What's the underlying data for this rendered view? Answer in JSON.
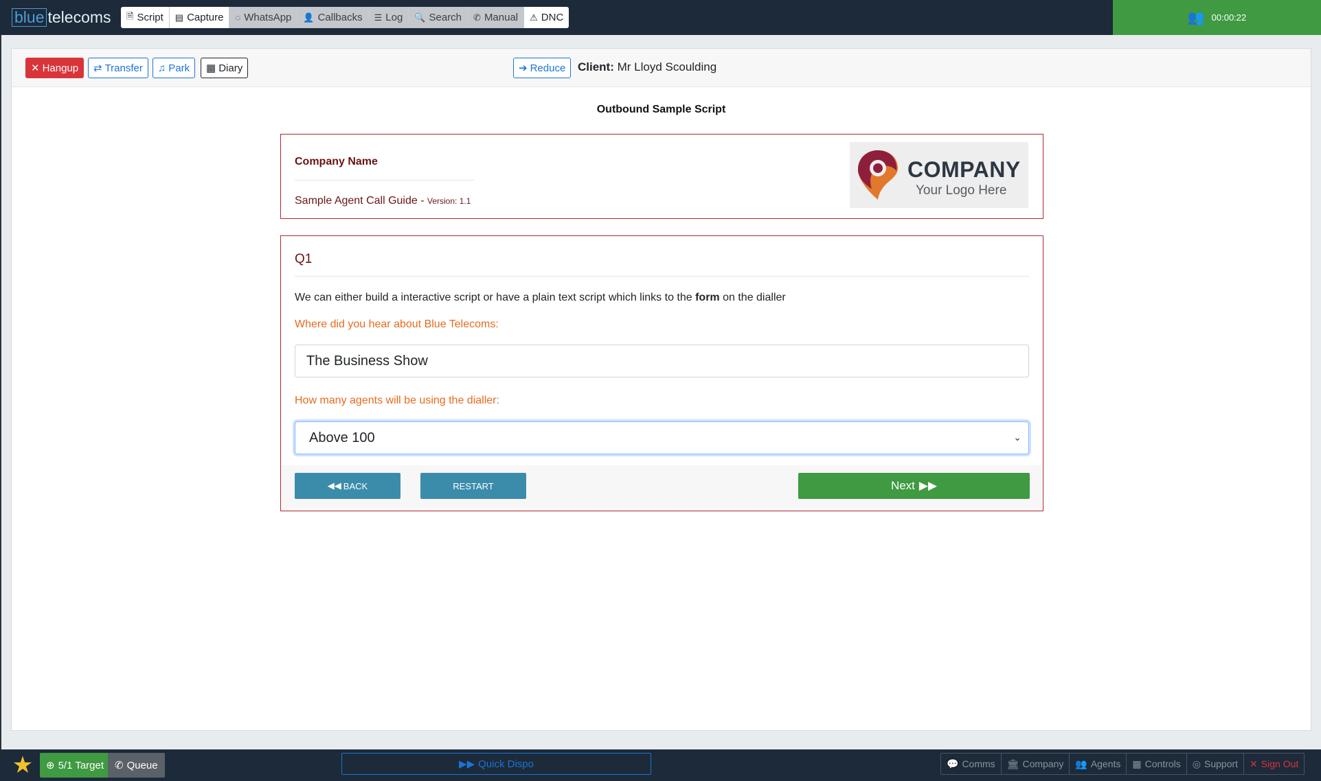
{
  "brand": {
    "part1": "blue",
    "part2": "telecoms"
  },
  "nav": [
    {
      "label": "Script",
      "icon": "file-icon",
      "glyph": "🗎"
    },
    {
      "label": "Capture",
      "icon": "list-alt-icon",
      "glyph": "▤"
    },
    {
      "label": "WhatsApp",
      "icon": "whatsapp-icon",
      "glyph": "◌"
    },
    {
      "label": "Callbacks",
      "icon": "user-clock-icon",
      "glyph": "👤"
    },
    {
      "label": "Log",
      "icon": "list-icon",
      "glyph": "☰"
    },
    {
      "label": "Search",
      "icon": "search-icon",
      "glyph": "🔍"
    },
    {
      "label": "Manual",
      "icon": "phone-icon",
      "glyph": "✆"
    },
    {
      "label": "DNC",
      "icon": "warning-icon",
      "glyph": "⚠"
    }
  ],
  "timer": {
    "value": "00:00:22",
    "icon": "users-icon"
  },
  "call_actions": {
    "hangup": "Hangup",
    "transfer": "Transfer",
    "park": "Park",
    "diary": "Diary",
    "reduce": "Reduce"
  },
  "client": {
    "label": "Client:",
    "name": "Mr Lloyd Scoulding"
  },
  "script": {
    "title": "Outbound Sample Script",
    "company_name": "Company Name",
    "guide": "Sample Agent Call Guide - ",
    "version": "Version: 1.1",
    "logo": {
      "title": "COMPANY",
      "subtitle": "Your Logo Here"
    }
  },
  "question": {
    "title": "Q1",
    "text_before": "We can either build a interactive script or have a plain text script which links to the ",
    "text_bold": "form",
    "text_after": " on the dialler",
    "label1": "Where did you hear about Blue Telecoms:",
    "answer1": "The Business Show",
    "label2": "How many agents will be using the dialler:",
    "answer2": "Above 100"
  },
  "footer_buttons": {
    "back": "BACK",
    "restart": "RESTART",
    "next": "Next"
  },
  "bottom": {
    "target": "5/1 Target",
    "queue": "Queue",
    "quick_dispo": "Quick Dispo",
    "right": [
      {
        "label": "Comms",
        "icon": "comments-icon",
        "glyph": "💬"
      },
      {
        "label": "Company",
        "icon": "building-icon",
        "glyph": "🏛"
      },
      {
        "label": "Agents",
        "icon": "users-icon",
        "glyph": "👥"
      },
      {
        "label": "Controls",
        "icon": "grid-icon",
        "glyph": "▦"
      },
      {
        "label": "Support",
        "icon": "lifering-icon",
        "glyph": "◎"
      },
      {
        "label": "Sign Out",
        "icon": "close-icon",
        "glyph": "✕"
      }
    ]
  },
  "colors": {
    "navbar": "#1c2a3a",
    "success": "#3f9a42",
    "danger": "#d9343a",
    "primary": "#1a74d8",
    "info": "#3b8cab",
    "accent_label": "#e86a1e",
    "border_red": "#b3262d"
  }
}
